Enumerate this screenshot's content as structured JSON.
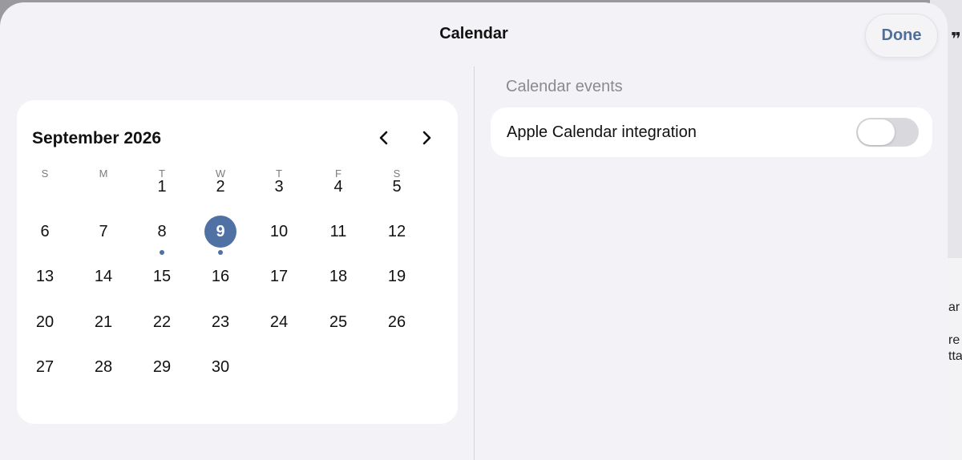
{
  "sheet": {
    "title": "Calendar",
    "done_label": "Done"
  },
  "calendar": {
    "month_label": "September 2026",
    "prev_icon": "chevron-left-icon",
    "next_icon": "chevron-right-icon",
    "weekdays": [
      "S",
      "M",
      "T",
      "W",
      "T",
      "F",
      "S"
    ],
    "weeks": [
      [
        "",
        "",
        "1",
        "2",
        "3",
        "4",
        "5"
      ],
      [
        "6",
        "7",
        "8",
        "9",
        "10",
        "11",
        "12"
      ],
      [
        "13",
        "14",
        "15",
        "16",
        "17",
        "18",
        "19"
      ],
      [
        "20",
        "21",
        "22",
        "23",
        "24",
        "25",
        "26"
      ],
      [
        "27",
        "28",
        "29",
        "30",
        "",
        "",
        ""
      ]
    ],
    "selected_day": "9",
    "days_with_events": [
      "8",
      "9"
    ],
    "accent_color": "#4f71a4"
  },
  "settings": {
    "section_header": "Calendar events",
    "integration_label": "Apple Calendar integration",
    "integration_enabled": false
  },
  "background": {
    "quote_glyph": "❞",
    "text_lines": [
      "ar",
      "re",
      "tta"
    ]
  }
}
